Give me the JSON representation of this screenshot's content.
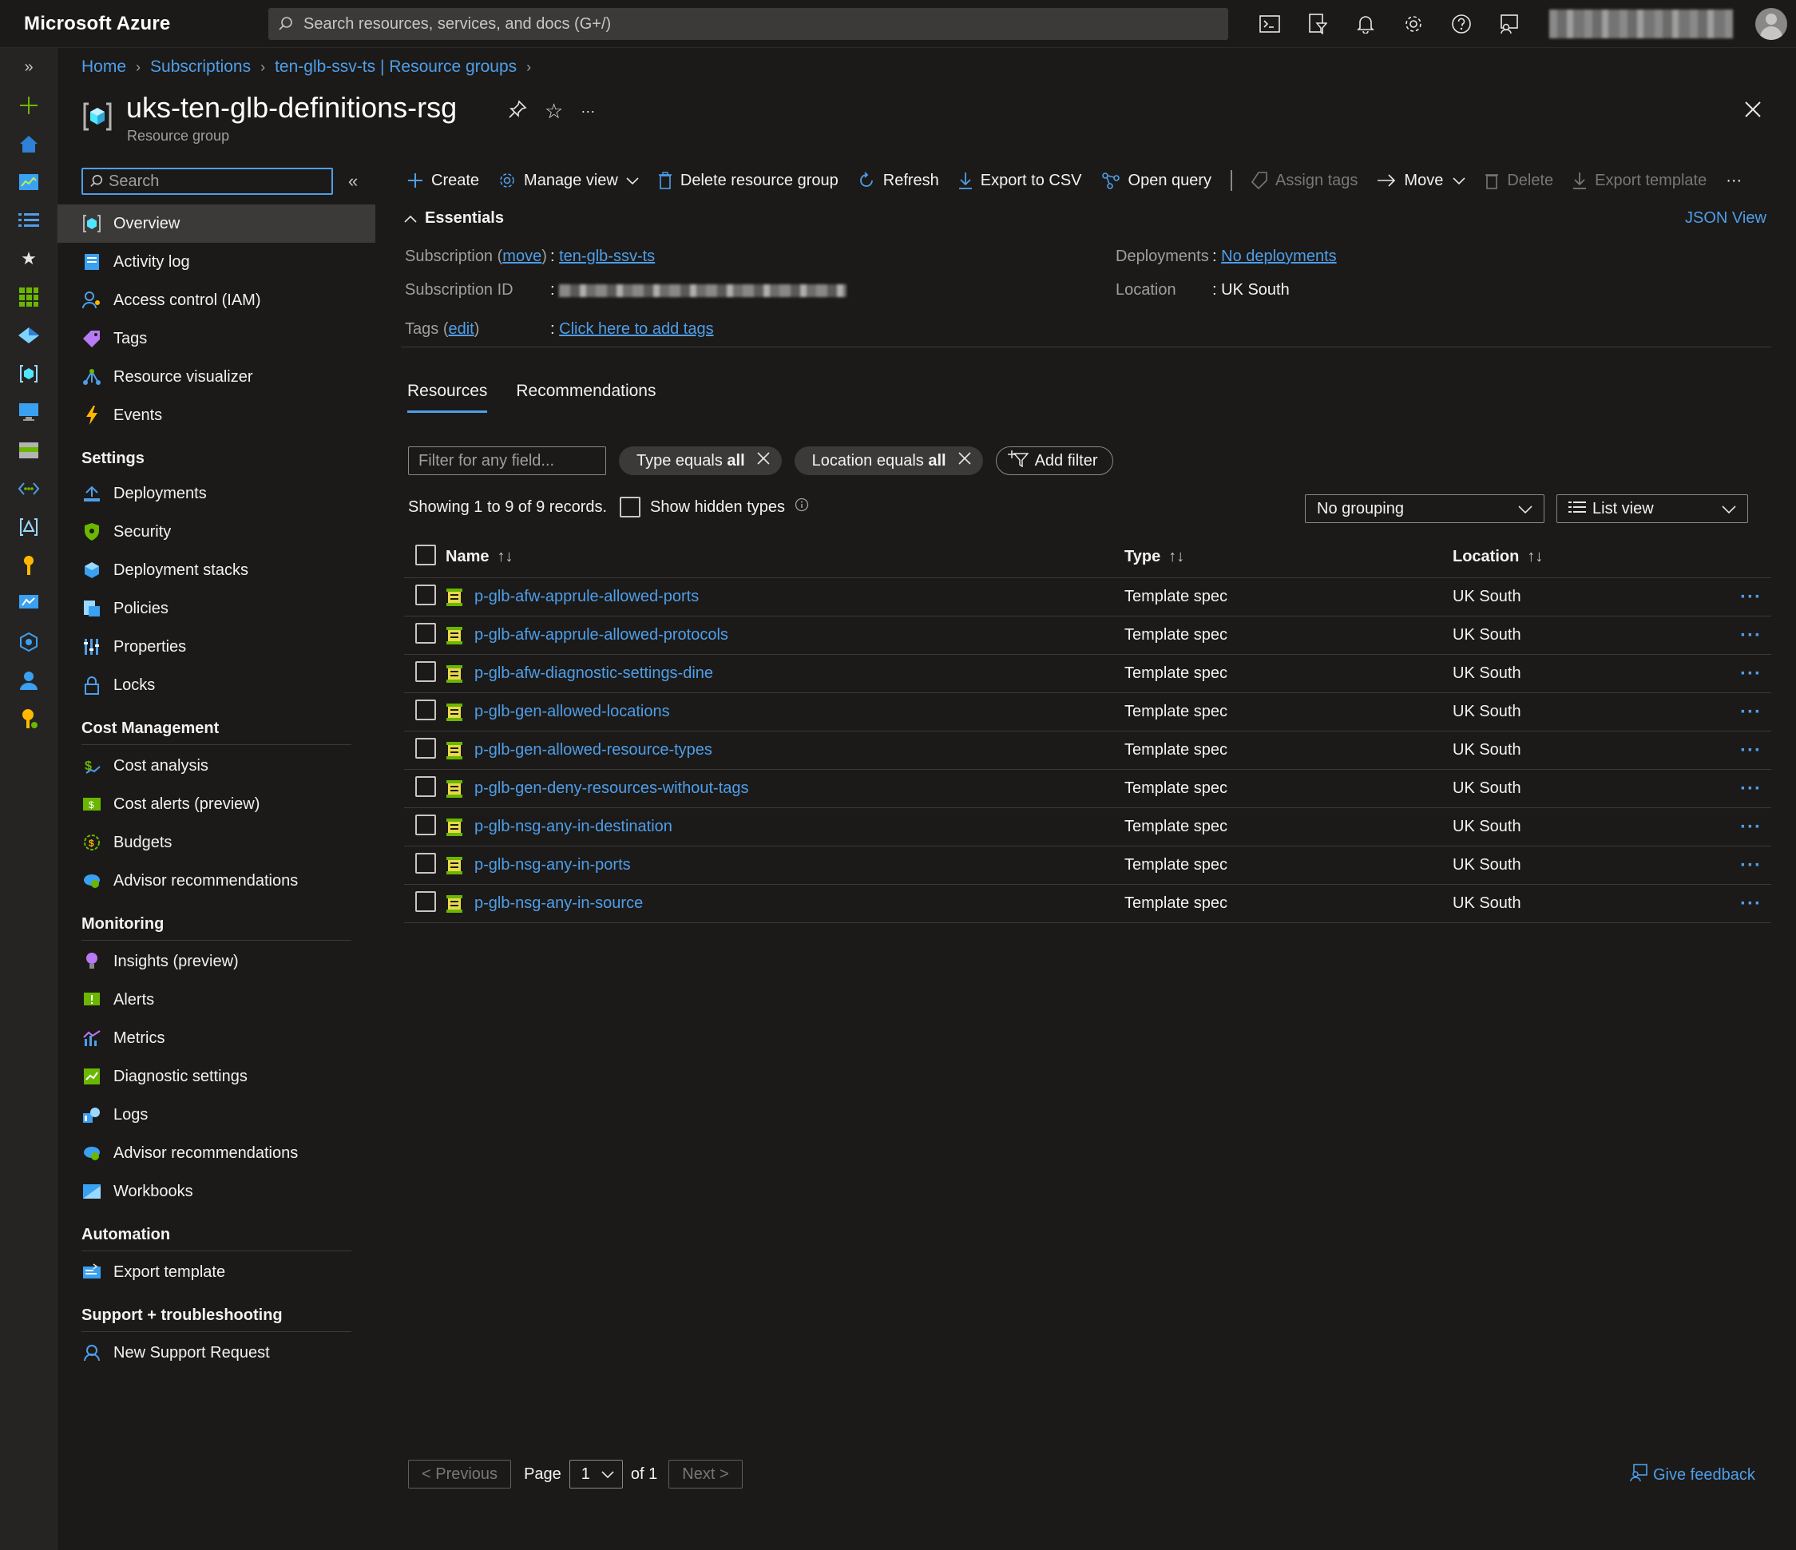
{
  "app": {
    "brand": "Microsoft Azure"
  },
  "search": {
    "placeholder": "Search resources, services, and docs (G+/)"
  },
  "topbar_icons": [
    "cloud-shell-icon",
    "directory-filter-icon",
    "bell-icon",
    "gear-icon",
    "help-icon",
    "feedback-icon"
  ],
  "breadcrumb": [
    "Home",
    "Subscriptions",
    "ten-glb-ssv-ts | Resource groups"
  ],
  "page": {
    "title": "uks-ten-glb-definitions-rsg",
    "subtitle": "Resource group",
    "more": "···"
  },
  "menu": {
    "search_placeholder": "Search",
    "collapse": "«",
    "top_items": [
      {
        "label": "Overview",
        "icon": "resource-group-icon",
        "color": "#50e6ff"
      },
      {
        "label": "Activity log",
        "icon": "activity-log-icon",
        "color": "#4f9ee8"
      },
      {
        "label": "Access control (IAM)",
        "icon": "iam-icon",
        "color": "#4f9ee8"
      },
      {
        "label": "Tags",
        "icon": "tag-icon",
        "color": "#b77af4"
      },
      {
        "label": "Resource visualizer",
        "icon": "visualizer-icon",
        "color": "#4f9ee8"
      },
      {
        "label": "Events",
        "icon": "lightning-icon",
        "color": "#ffb900"
      }
    ],
    "sections": [
      {
        "title": "Settings",
        "items": [
          {
            "label": "Deployments",
            "icon": "deployments-icon"
          },
          {
            "label": "Security",
            "icon": "shield-icon"
          },
          {
            "label": "Deployment stacks",
            "icon": "stacks-icon"
          },
          {
            "label": "Policies",
            "icon": "policy-icon"
          },
          {
            "label": "Properties",
            "icon": "properties-icon"
          },
          {
            "label": "Locks",
            "icon": "lock-icon"
          }
        ]
      },
      {
        "title": "Cost Management",
        "items": [
          {
            "label": "Cost analysis",
            "icon": "cost-analysis-icon"
          },
          {
            "label": "Cost alerts (preview)",
            "icon": "cost-alert-icon"
          },
          {
            "label": "Budgets",
            "icon": "budget-icon"
          },
          {
            "label": "Advisor recommendations",
            "icon": "advisor-icon"
          }
        ]
      },
      {
        "title": "Monitoring",
        "items": [
          {
            "label": "Insights (preview)",
            "icon": "insights-icon"
          },
          {
            "label": "Alerts",
            "icon": "alert-icon"
          },
          {
            "label": "Metrics",
            "icon": "metrics-icon"
          },
          {
            "label": "Diagnostic settings",
            "icon": "diagnostic-icon"
          },
          {
            "label": "Logs",
            "icon": "logs-icon"
          },
          {
            "label": "Advisor recommendations",
            "icon": "advisor-icon"
          },
          {
            "label": "Workbooks",
            "icon": "workbook-icon"
          }
        ]
      },
      {
        "title": "Automation",
        "items": [
          {
            "label": "Export template",
            "icon": "export-template-icon"
          }
        ]
      },
      {
        "title": "Support + troubleshooting",
        "items": [
          {
            "label": "New Support Request",
            "icon": "support-icon"
          }
        ]
      }
    ]
  },
  "commands": {
    "create": "Create",
    "manage_view": "Manage view",
    "delete_rg": "Delete resource group",
    "refresh": "Refresh",
    "export_csv": "Export to CSV",
    "open_query": "Open query",
    "assign_tags": "Assign tags",
    "move": "Move",
    "delete": "Delete",
    "export_template": "Export template",
    "more": "···"
  },
  "essentials": {
    "title": "Essentials",
    "json_view": "JSON View",
    "subscription_label": "Subscription",
    "move_link": "move",
    "subscription_value": "ten-glb-ssv-ts",
    "subscription_id_label": "Subscription ID",
    "tags_label": "Tags",
    "edit_link": "edit",
    "tags_value": "Click here to add tags",
    "deployments_label": "Deployments",
    "deployments_value": "No deployments",
    "location_label": "Location",
    "location_value": "UK South"
  },
  "tabs": [
    "Resources",
    "Recommendations"
  ],
  "filters": {
    "placeholder": "Filter for any field...",
    "type_prefix": "Type equals",
    "type_value": "all",
    "location_prefix": "Location equals",
    "location_value": "all",
    "add_filter": "Add filter"
  },
  "listing": {
    "showing": "Showing 1 to 9 of 9 records.",
    "show_hidden": "Show hidden types",
    "grouping": "No grouping",
    "view": "List view"
  },
  "table": {
    "headers": {
      "name": "Name",
      "type": "Type",
      "location": "Location"
    },
    "rows": [
      {
        "name": "p-glb-afw-apprule-allowed-ports",
        "type": "Template spec",
        "location": "UK South"
      },
      {
        "name": "p-glb-afw-apprule-allowed-protocols",
        "type": "Template spec",
        "location": "UK South"
      },
      {
        "name": "p-glb-afw-diagnostic-settings-dine",
        "type": "Template spec",
        "location": "UK South"
      },
      {
        "name": "p-glb-gen-allowed-locations",
        "type": "Template spec",
        "location": "UK South"
      },
      {
        "name": "p-glb-gen-allowed-resource-types",
        "type": "Template spec",
        "location": "UK South"
      },
      {
        "name": "p-glb-gen-deny-resources-without-tags",
        "type": "Template spec",
        "location": "UK South"
      },
      {
        "name": "p-glb-nsg-any-in-destination",
        "type": "Template spec",
        "location": "UK South"
      },
      {
        "name": "p-glb-nsg-any-in-ports",
        "type": "Template spec",
        "location": "UK South"
      },
      {
        "name": "p-glb-nsg-any-in-source",
        "type": "Template spec",
        "location": "UK South"
      }
    ]
  },
  "pager": {
    "previous": "< Previous",
    "page_label": "Page",
    "page_value": "1",
    "of": "of 1",
    "next": "Next >"
  },
  "feedback": "Give feedback"
}
